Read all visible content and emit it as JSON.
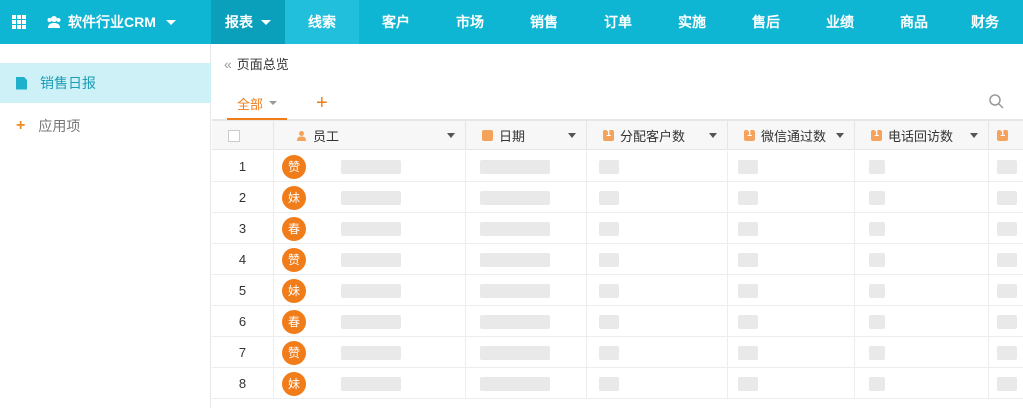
{
  "app": {
    "name": "软件行业CRM"
  },
  "nav": [
    "报表",
    "线索",
    "客户",
    "市场",
    "销售",
    "订单",
    "实施",
    "售后",
    "业绩",
    "商品",
    "财务"
  ],
  "sidebar": {
    "items": [
      {
        "label": "销售日报"
      },
      {
        "label": "应用项"
      }
    ]
  },
  "breadcrumb": {
    "title": "页面总览"
  },
  "tabs": {
    "all_label": "全部",
    "add_label": "+"
  },
  "table": {
    "columns": [
      "员工",
      "日期",
      "分配客户数",
      "微信通过数",
      "电话回访数"
    ],
    "rows": [
      {
        "index": "1",
        "avatar": "赞"
      },
      {
        "index": "2",
        "avatar": "妹"
      },
      {
        "index": "3",
        "avatar": "春"
      },
      {
        "index": "4",
        "avatar": "赞"
      },
      {
        "index": "5",
        "avatar": "妹"
      },
      {
        "index": "6",
        "avatar": "春"
      },
      {
        "index": "7",
        "avatar": "赞"
      },
      {
        "index": "8",
        "avatar": "妹"
      }
    ]
  },
  "colors": {
    "topbar": "#0fb6d4",
    "accent_orange": "#f07c1a",
    "sidebar_active": "#cdf1f7"
  }
}
